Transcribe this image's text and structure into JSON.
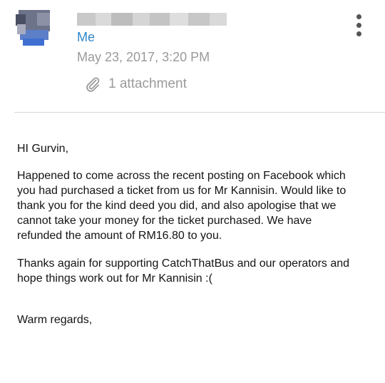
{
  "header": {
    "sender_name": "Me",
    "date": "May 23, 2017, 3:20 PM",
    "attachment_label": "1 attachment"
  },
  "message": {
    "greeting": "HI Gurvin,",
    "paragraph1_lines": [
      "Happened to come across the recent posting on Facebook which",
      "you had purchased a ticket from us for Mr Kannisin. Would like to",
      "thank you for the kind deed you did, and also apologise that we",
      "cannot take your money for the ticket purchased. We have",
      "refunded the amount of RM16.80 to you."
    ],
    "paragraph2_lines": [
      "Thanks again for supporting CatchThatBus and our operators and",
      "hope things work out for Mr Kannisin :("
    ],
    "signoff": "Warm regards,"
  },
  "colors": {
    "link_blue": "#2f86c8",
    "muted_gray": "#9a9a9a",
    "text": "#141414"
  },
  "icons": {
    "attachment": "paperclip-icon",
    "more": "more-vertical-icon"
  }
}
